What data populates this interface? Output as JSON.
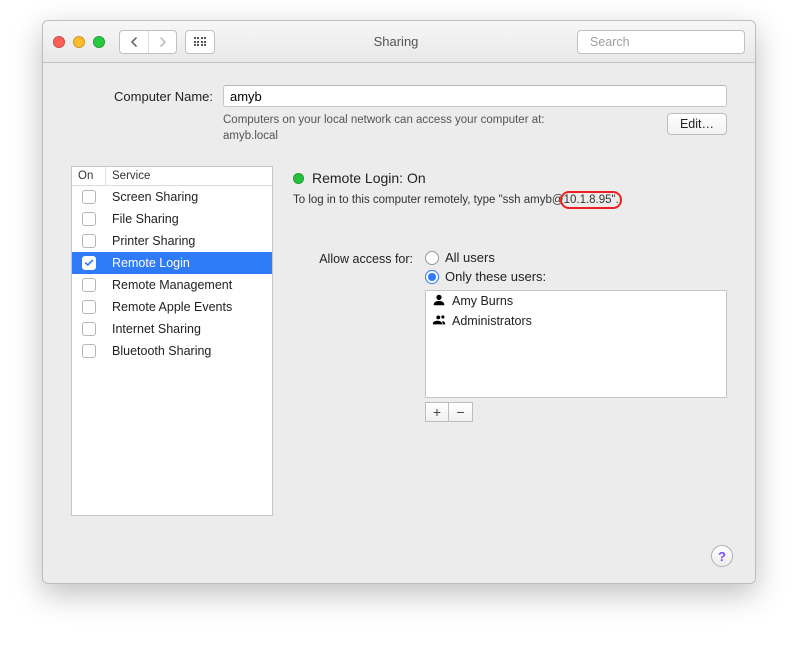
{
  "window": {
    "title": "Sharing",
    "search_placeholder": "Search"
  },
  "computer_name": {
    "label": "Computer Name:",
    "value": "amyb",
    "subtext_line1": "Computers on your local network can access your computer at:",
    "subtext_line2": "amyb.local",
    "edit_label": "Edit…"
  },
  "service_table": {
    "header_on": "On",
    "header_service": "Service",
    "rows": [
      {
        "label": "Screen Sharing",
        "on": false,
        "selected": false
      },
      {
        "label": "File Sharing",
        "on": false,
        "selected": false
      },
      {
        "label": "Printer Sharing",
        "on": false,
        "selected": false
      },
      {
        "label": "Remote Login",
        "on": true,
        "selected": true
      },
      {
        "label": "Remote Management",
        "on": false,
        "selected": false
      },
      {
        "label": "Remote Apple Events",
        "on": false,
        "selected": false
      },
      {
        "label": "Internet Sharing",
        "on": false,
        "selected": false
      },
      {
        "label": "Bluetooth Sharing",
        "on": false,
        "selected": false
      }
    ]
  },
  "detail": {
    "status_title": "Remote Login: On",
    "instruction_prefix": "To log in to this computer remotely, type \"ssh amyb@",
    "instruction_ip": "10.1.8.95",
    "instruction_suffix": "\".",
    "allow_label": "Allow access for:",
    "radio_all": "All users",
    "radio_only": "Only these users:",
    "users": [
      {
        "name": "Amy Burns",
        "type": "user"
      },
      {
        "name": "Administrators",
        "type": "group"
      }
    ],
    "plus": "+",
    "minus": "−"
  },
  "help": "?"
}
